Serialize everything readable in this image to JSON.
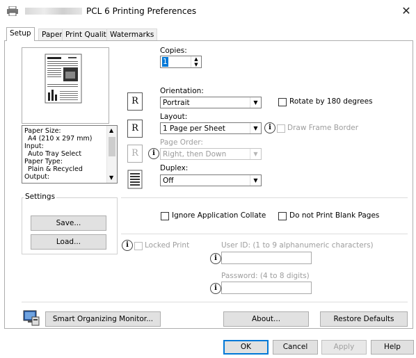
{
  "window": {
    "title": "PCL 6 Printing Preferences",
    "close_glyph": "✕"
  },
  "tabs": [
    {
      "label": "Setup"
    },
    {
      "label": "Paper"
    },
    {
      "label": "Print Quality"
    },
    {
      "label": "Watermarks"
    }
  ],
  "summary": {
    "lines": [
      "Paper Size:",
      "  A4 (210 x 297 mm)",
      "Input:",
      "  Auto Tray Select",
      "Paper Type:",
      "  Plain & Recycled",
      "Output:"
    ]
  },
  "settings": {
    "label": "Settings",
    "save": "Save...",
    "load": "Load..."
  },
  "copies": {
    "label": "Copies:",
    "value": "1"
  },
  "orientation": {
    "label": "Orientation:",
    "value": "Portrait",
    "rotate_label": "Rotate by 180 degrees"
  },
  "layout": {
    "label": "Layout:",
    "value": "1 Page per Sheet",
    "frame_label": "Draw Frame Border"
  },
  "page_order": {
    "label": "Page Order:",
    "value": "Right, then Down"
  },
  "duplex": {
    "label": "Duplex:",
    "value": "Off"
  },
  "options": {
    "collate": "Ignore Application Collate",
    "blank": "Do not Print Blank Pages"
  },
  "locked": {
    "label": "Locked Print",
    "user_id": "User ID: (1 to 9 alphanumeric characters)",
    "password": "Password: (4 to 8 digits)"
  },
  "bottom": {
    "monitor": "Smart Organizing Monitor...",
    "about": "About...",
    "restore": "Restore Defaults"
  },
  "dialog": {
    "ok": "OK",
    "cancel": "Cancel",
    "apply": "Apply",
    "help": "Help"
  },
  "icons": {
    "orientation_icon": "R",
    "layout_icon": "R",
    "page_order_icon": "R",
    "info_glyph": "i"
  }
}
